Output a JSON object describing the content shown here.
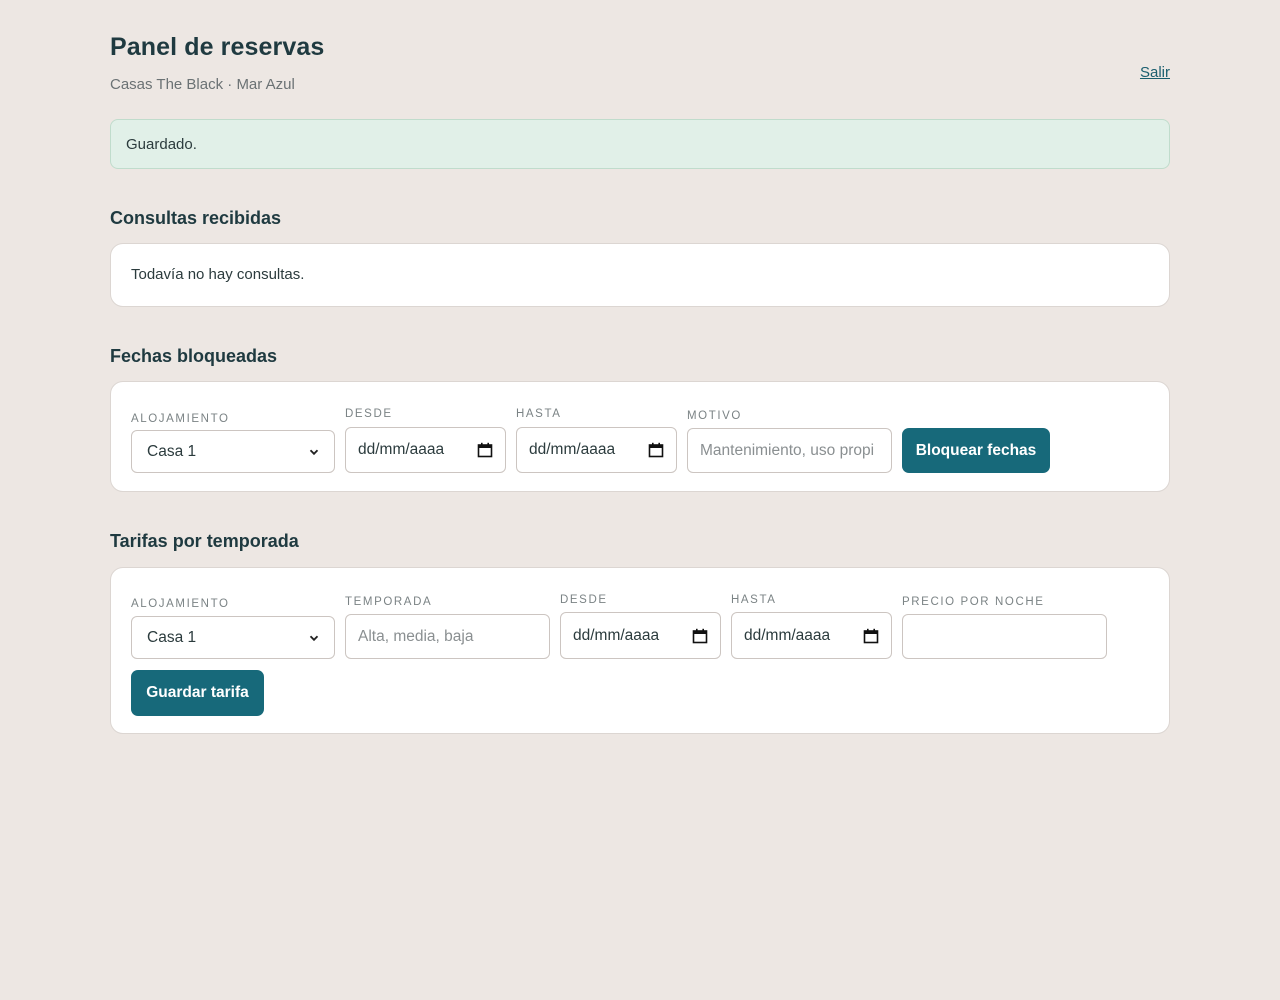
{
  "header": {
    "title": "Panel de reservas",
    "subtitle": "Casas The Black · Mar Azul",
    "logout_label": "Salir"
  },
  "flash": {
    "message": "Guardado."
  },
  "inquiries": {
    "title": "Consultas recibidas",
    "empty_text": "Todavía no hay consultas."
  },
  "blocked_dates": {
    "title": "Fechas bloqueadas",
    "fields": {
      "alojamiento": {
        "label": "Alojamiento",
        "value": "Casa 1"
      },
      "desde": {
        "label": "Desde",
        "value": "dd/mm/aaaa"
      },
      "hasta": {
        "label": "Hasta",
        "value": "dd/mm/aaaa"
      },
      "motivo": {
        "label": "Motivo",
        "placeholder": "Mantenimiento, uso propi"
      }
    },
    "submit_label": "Bloquear fechas"
  },
  "seasonal_rates": {
    "title": "Tarifas por temporada",
    "fields": {
      "alojamiento": {
        "label": "Alojamiento",
        "value": "Casa 1"
      },
      "temporada": {
        "label": "Temporada",
        "placeholder": "Alta, media, baja"
      },
      "desde": {
        "label": "Desde",
        "value": "dd/mm/aaaa"
      },
      "hasta": {
        "label": "Hasta",
        "value": "dd/mm/aaaa"
      },
      "precio": {
        "label": "Precio por noche",
        "value": ""
      }
    },
    "submit_label": "Guardar tarifa"
  },
  "colors": {
    "background": "#ede7e3",
    "accent": "#17697a",
    "flash_background": "#e1f0e8",
    "heading": "#1f3a40"
  },
  "icons": {
    "select_chevron": "chevron-down-icon",
    "date_picker": "calendar-icon"
  }
}
